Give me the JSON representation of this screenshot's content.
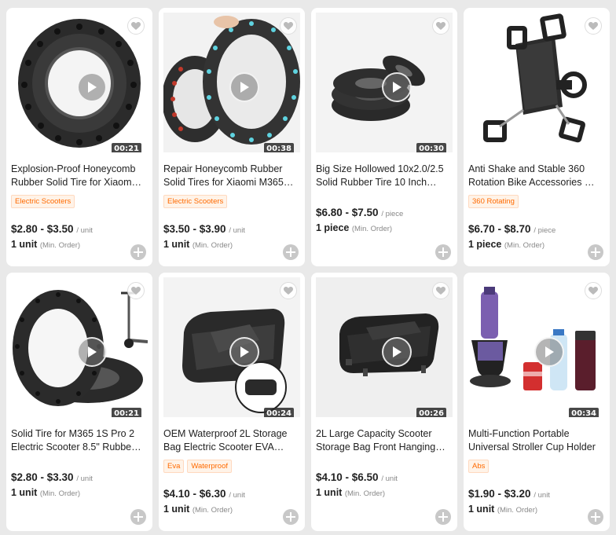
{
  "products": [
    {
      "title_line1": "Explosion-Proof Honeycomb",
      "title_line2": "Rubber Solid Tire for Xiaomi…",
      "tags": [
        "Electric Scooters"
      ],
      "price": "$2.80 - $3.50",
      "unit": "/ unit",
      "moq": "1 unit",
      "moq_label": "(Min. Order)",
      "duration": "00:21",
      "image": "honeycomb-tire"
    },
    {
      "title_line1": "Repair Honeycomb Rubber",
      "title_line2": "Solid Tires for Xiaomi M365…",
      "tags": [
        "Electric Scooters"
      ],
      "price": "$3.50 - $3.90",
      "unit": "/ unit",
      "moq": "1 unit",
      "moq_label": "(Min. Order)",
      "duration": "00:38",
      "image": "two-tires"
    },
    {
      "title_line1": "Big Size Hollowed 10x2.0/2.5",
      "title_line2": "Solid Rubber Tire 10 Inch…",
      "tags": [],
      "price": "$6.80 - $7.50",
      "unit": "/ piece",
      "moq": "1 piece",
      "moq_label": "(Min. Order)",
      "duration": "00:30",
      "image": "stacked-tires"
    },
    {
      "title_line1": "Anti Shake and Stable 360",
      "title_line2": "Rotation Bike Accessories Bik…",
      "tags": [
        "360 Rotating"
      ],
      "price": "$6.70 - $8.70",
      "unit": "/ piece",
      "moq": "1 piece",
      "moq_label": "(Min. Order)",
      "duration": "",
      "image": "phone-holder"
    },
    {
      "title_line1": "Solid Tire for M365 1S Pro 2",
      "title_line2": "Electric Scooter 8.5\" Rubber…",
      "tags": [],
      "price": "$2.80 - $3.30",
      "unit": "/ unit",
      "moq": "1 unit",
      "moq_label": "(Min. Order)",
      "duration": "00:21",
      "image": "tire-scooter"
    },
    {
      "title_line1": "OEM Waterproof 2L Storage",
      "title_line2": "Bag Electric Scooter EVA…",
      "tags": [
        "Eva",
        "Waterproof"
      ],
      "price": "$4.10 - $6.30",
      "unit": "/ unit",
      "moq": "1 unit",
      "moq_label": "(Min. Order)",
      "duration": "00:24",
      "image": "eva-bag"
    },
    {
      "title_line1": "2L Large Capacity Scooter",
      "title_line2": "Storage Bag Front Hanging Ba…",
      "tags": [],
      "price": "$4.10 - $6.50",
      "unit": "/ unit",
      "moq": "1 unit",
      "moq_label": "(Min. Order)",
      "duration": "00:26",
      "image": "hanging-bag"
    },
    {
      "title_line1": "Multi-Function Portable",
      "title_line2": "Universal Stroller Cup Holder",
      "tags": [
        "Abs"
      ],
      "price": "$1.90 - $3.20",
      "unit": "/ unit",
      "moq": "1 unit",
      "moq_label": "(Min. Order)",
      "duration": "00:34",
      "image": "cup-holder"
    }
  ],
  "colors": {
    "tag_text": "#ff6a00",
    "tag_bg": "#fff3e8"
  }
}
